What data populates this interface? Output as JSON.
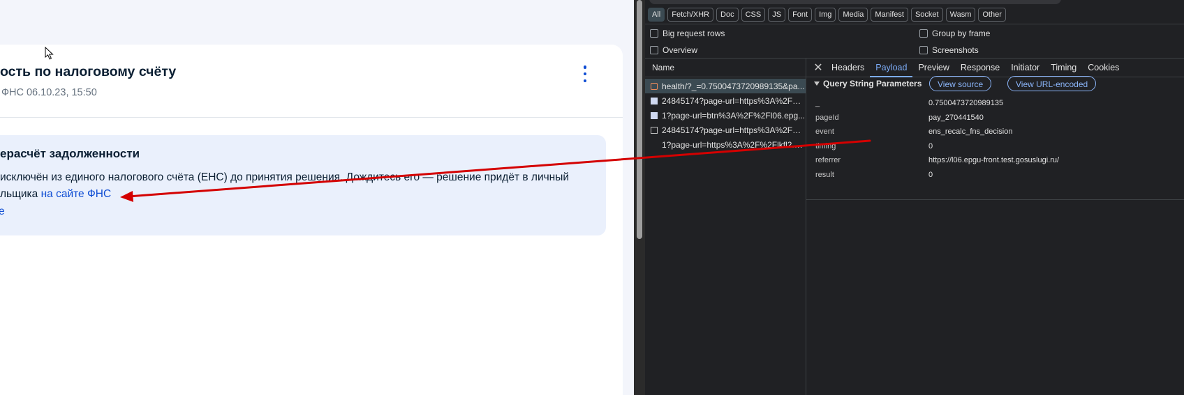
{
  "page": {
    "card_title": "ость по налоговому счёту",
    "card_meta": "ФНС 06.10.23, 15:50",
    "info": {
      "title": "ерасчёт задолженности",
      "line1": "исключён из единого налогового счёта (ЕНС) до принятия решения. Дождитесь его — решение придёт в личный",
      "line2_prefix": "льщика ",
      "link": "на сайте ФНС",
      "more": "е"
    }
  },
  "devtools": {
    "filter_types": [
      "All",
      "Fetch/XHR",
      "Doc",
      "CSS",
      "JS",
      "Font",
      "Img",
      "Media",
      "Manifest",
      "Socket",
      "Wasm",
      "Other"
    ],
    "active_filter": "All",
    "options": {
      "big_request_rows": "Big request rows",
      "overview": "Overview",
      "group_by_frame": "Group by frame",
      "screenshots": "Screenshots"
    },
    "name_header": "Name",
    "requests": [
      {
        "name": "health/?_=0.7500473720989135&pa...",
        "icon": "xhr-icon",
        "selected": true
      },
      {
        "name": "24845174?page-url=https%3A%2F%...",
        "icon": "document-icon",
        "selected": false
      },
      {
        "name": "1?page-url=btn%3A%2F%2Fl06.epg...",
        "icon": "document-icon",
        "selected": false
      },
      {
        "name": "24845174?page-url=https%3A%2F%...",
        "icon": "blank-file-icon",
        "selected": false
      },
      {
        "name": "1?page-url=https%3A%2F%2Flkfl2.n...",
        "icon": "none",
        "selected": false
      }
    ],
    "tabs": [
      "Headers",
      "Payload",
      "Preview",
      "Response",
      "Initiator",
      "Timing",
      "Cookies"
    ],
    "active_tab": "Payload",
    "section_title": "Query String Parameters",
    "view_source": "View source",
    "view_url_encoded": "View URL-encoded",
    "params": [
      {
        "key": "_",
        "value": "0.7500473720989135"
      },
      {
        "key": "pageId",
        "value": "pay_270441540"
      },
      {
        "key": "event",
        "value": "ens_recalc_fns_decision"
      },
      {
        "key": "timing",
        "value": "0"
      },
      {
        "key": "referrer",
        "value": "https://l06.epgu-front.test.gosuslugi.ru/"
      },
      {
        "key": "result",
        "value": "0"
      }
    ]
  },
  "colors": {
    "accent_blue": "#0d4cd3",
    "annotation_arrow": "#d40000",
    "devtools_bg": "#202124",
    "devtools_accent": "#7cacf8"
  }
}
